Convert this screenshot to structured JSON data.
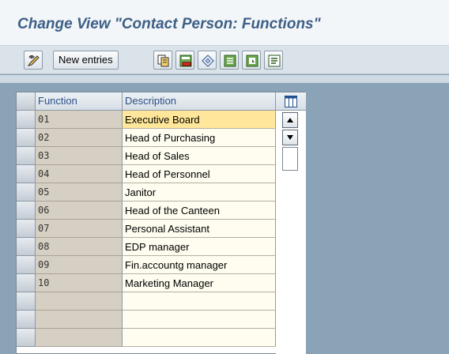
{
  "window": {
    "title": "Change View \"Contact Person: Functions\""
  },
  "toolbar": {
    "items": [
      {
        "name": "display-change-icon",
        "kind": "icon"
      },
      {
        "name": "new-entries-button",
        "kind": "text",
        "label": "New entries"
      },
      {
        "name": "copy-as-icon",
        "kind": "icon"
      },
      {
        "name": "delete-icon",
        "kind": "icon"
      },
      {
        "name": "undo-change-icon",
        "kind": "icon"
      },
      {
        "name": "select-all-icon",
        "kind": "icon"
      },
      {
        "name": "select-block-icon",
        "kind": "icon"
      },
      {
        "name": "deselect-all-icon",
        "kind": "icon"
      }
    ]
  },
  "table": {
    "columns": [
      "Function",
      "Description"
    ],
    "rows": [
      {
        "code": "01",
        "description": "Executive Board"
      },
      {
        "code": "02",
        "description": "Head of Purchasing"
      },
      {
        "code": "03",
        "description": "Head of Sales"
      },
      {
        "code": "04",
        "description": "Head of Personnel"
      },
      {
        "code": "05",
        "description": "Janitor"
      },
      {
        "code": "06",
        "description": "Head of the Canteen"
      },
      {
        "code": "07",
        "description": "Personal Assistant"
      },
      {
        "code": "08",
        "description": "EDP manager"
      },
      {
        "code": "09",
        "description": "Fin.accountg manager"
      },
      {
        "code": "10",
        "description": "Marketing Manager"
      },
      {
        "code": "",
        "description": ""
      },
      {
        "code": "",
        "description": ""
      },
      {
        "code": "",
        "description": ""
      }
    ],
    "active_row": 0
  },
  "colors": {
    "title_text": "#3d5f86",
    "header_text": "#2b4f86",
    "active_cell": "#ffe69a",
    "background": "#8aa3b6"
  }
}
